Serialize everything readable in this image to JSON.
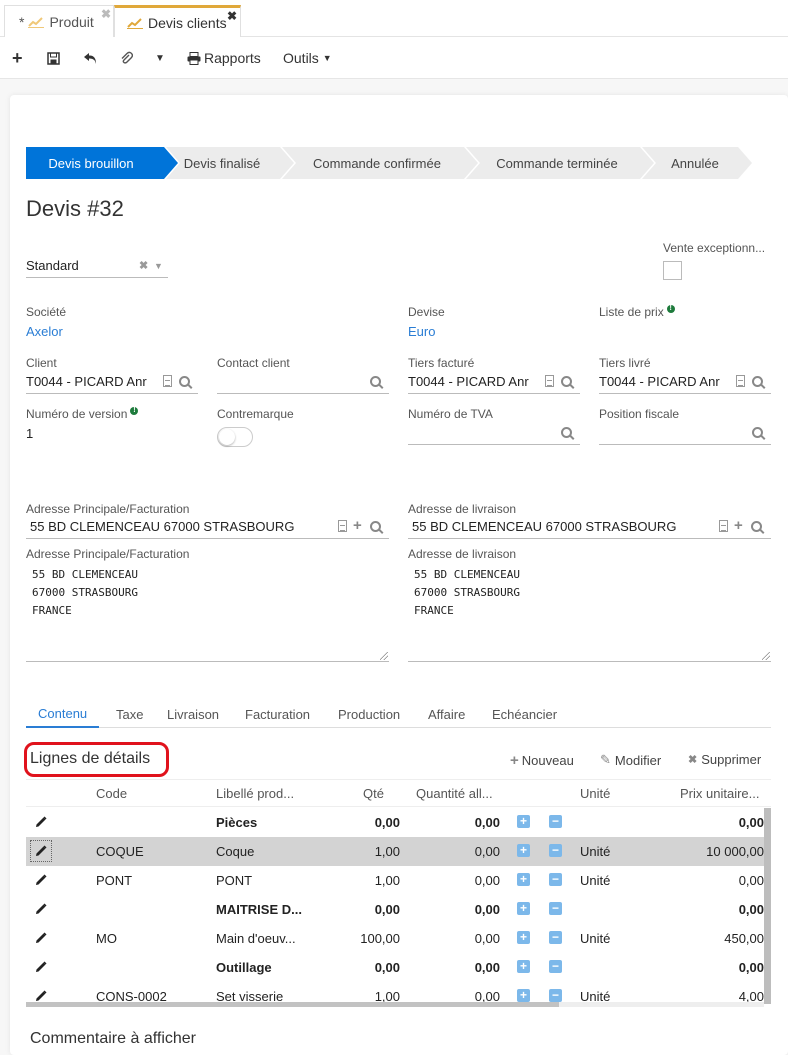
{
  "tabs": [
    {
      "label": "Produit",
      "modified_marker": "*",
      "active": false
    },
    {
      "label": "Devis clients",
      "modified_marker": "",
      "active": true
    }
  ],
  "toolbar": {
    "new_icon": "plus-icon",
    "save_icon": "save-icon",
    "undo_icon": "undo-icon",
    "attach_icon": "paperclip-icon",
    "reports_label": "Rapports",
    "tools_label": "Outils"
  },
  "status_steps": [
    {
      "label": "Devis brouillon",
      "active": true
    },
    {
      "label": "Devis finalisé",
      "active": false
    },
    {
      "label": "Commande confirmée",
      "active": false
    },
    {
      "label": "Commande terminée",
      "active": false
    },
    {
      "label": "Annulée",
      "active": false
    }
  ],
  "title": "Devis #32",
  "form": {
    "type_select": {
      "value": "Standard"
    },
    "exceptional_sale": {
      "label": "Vente exceptionn...",
      "checked": false
    },
    "company": {
      "label": "Société",
      "value": "Axelor"
    },
    "currency": {
      "label": "Devise",
      "value": "Euro"
    },
    "price_list": {
      "label": "Liste de prix",
      "value": ""
    },
    "client": {
      "label": "Client",
      "value": "T0044 - PICARD Anr"
    },
    "client_contact": {
      "label": "Contact client",
      "value": ""
    },
    "invoiced_partner": {
      "label": "Tiers facturé",
      "value": "T0044 - PICARD Anr"
    },
    "delivered_partner": {
      "label": "Tiers livré",
      "value": "T0044 - PICARD Anr"
    },
    "version_number": {
      "label": "Numéro de version",
      "value": "1"
    },
    "counter_mark": {
      "label": "Contremarque",
      "on": false
    },
    "vat_number": {
      "label": "Numéro de TVA",
      "value": ""
    },
    "fiscal_position": {
      "label": "Position fiscale",
      "value": ""
    },
    "main_address": {
      "label": "Adresse Principale/Facturation",
      "value": "55 BD CLEMENCEAU 67000 STRASBOURG"
    },
    "delivery_address": {
      "label": "Adresse de livraison",
      "value": "55 BD CLEMENCEAU 67000 STRASBOURG"
    },
    "main_address_text": {
      "label": "Adresse Principale/Facturation",
      "value": "55 BD CLEMENCEAU\n67000 STRASBOURG\nFRANCE"
    },
    "delivery_address_text": {
      "label": "Adresse de livraison",
      "value": "55 BD CLEMENCEAU\n67000 STRASBOURG\nFRANCE"
    }
  },
  "notebook_tabs": [
    {
      "label": "Contenu",
      "active": true
    },
    {
      "label": "Taxe"
    },
    {
      "label": "Livraison"
    },
    {
      "label": "Facturation"
    },
    {
      "label": "Production"
    },
    {
      "label": "Affaire"
    },
    {
      "label": "Echéancier"
    }
  ],
  "details": {
    "title": "Lignes de détails",
    "actions": {
      "new": "Nouveau",
      "edit": "Modifier",
      "delete": "Supprimer"
    },
    "columns": [
      "Code",
      "Libellé prod...",
      "Qté",
      "Quantité all...",
      "Unité",
      "Prix unitaire..."
    ],
    "rows": [
      {
        "code": "",
        "label": "Pièces",
        "qty": "0,00",
        "alloc": "0,00",
        "unit": "",
        "price": "0,00",
        "bold": true,
        "selected": false
      },
      {
        "code": "COQUE",
        "label": "Coque",
        "qty": "1,00",
        "alloc": "0,00",
        "unit": "Unité",
        "price": "10 000,00",
        "bold": false,
        "selected": true
      },
      {
        "code": "PONT",
        "label": "PONT",
        "qty": "1,00",
        "alloc": "0,00",
        "unit": "Unité",
        "price": "0,00",
        "bold": false,
        "selected": false
      },
      {
        "code": "",
        "label": "MAITRISE D...",
        "qty": "0,00",
        "alloc": "0,00",
        "unit": "",
        "price": "0,00",
        "bold": true,
        "selected": false
      },
      {
        "code": "MO",
        "label": "Main d'oeuv...",
        "qty": "100,00",
        "alloc": "0,00",
        "unit": "Unité",
        "price": "450,00",
        "bold": false,
        "selected": false
      },
      {
        "code": "",
        "label": "Outillage",
        "qty": "0,00",
        "alloc": "0,00",
        "unit": "",
        "price": "0,00",
        "bold": true,
        "selected": false
      },
      {
        "code": "CONS-0002",
        "label": "Set visserie",
        "qty": "1,00",
        "alloc": "0,00",
        "unit": "Unité",
        "price": "4,00",
        "bold": false,
        "selected": false
      }
    ]
  },
  "footer_partial_text": "Commentaire à afficher"
}
